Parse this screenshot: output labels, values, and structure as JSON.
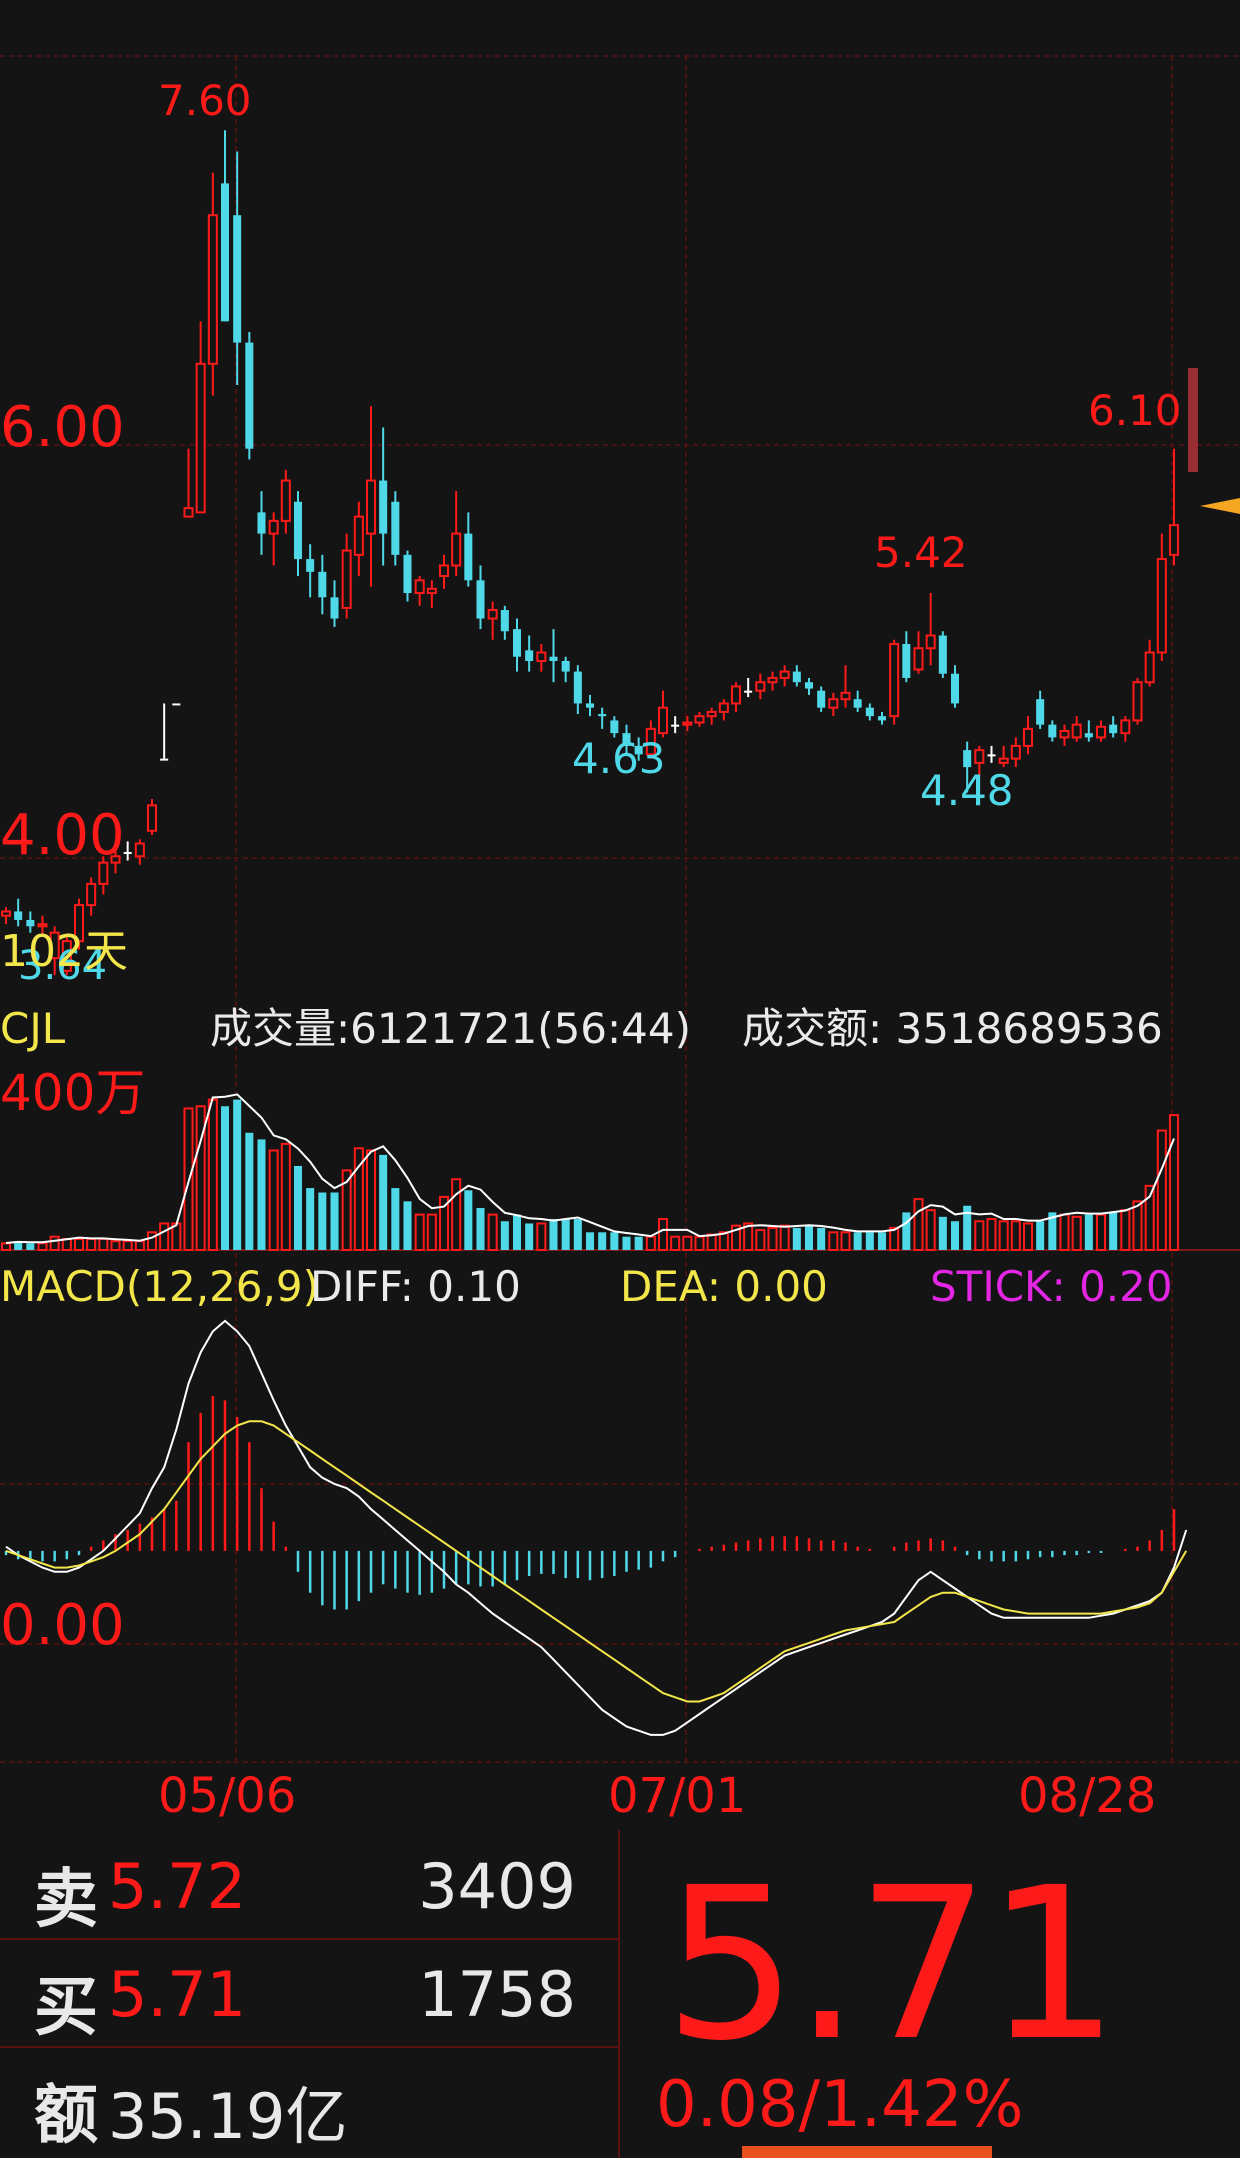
{
  "price_axis": {
    "label_high": "6.00",
    "label_low": "4.00"
  },
  "annotations": {
    "high": "7.60",
    "current_high": "6.10",
    "mid_high": "5.42",
    "low_1": "4.63",
    "low_2": "4.48",
    "low_left": "3.64",
    "days": "102天"
  },
  "volume": {
    "name": "CJL",
    "volume_text": "成交量:6121721(56:44)",
    "amount_text": "成交额: 3518689536",
    "axis_label": "400万"
  },
  "macd": {
    "name": "MACD(12,26,9)",
    "diff_text": "DIFF: 0.10",
    "dea_text": "DEA: 0.00",
    "stick_text": "STICK: 0.20",
    "axis_zero": "0.00"
  },
  "dates": [
    "05/06",
    "07/01",
    "08/28"
  ],
  "quote": {
    "sell_key": "卖",
    "sell_price": "5.72",
    "sell_volume": "3409",
    "buy_key": "买",
    "buy_price": "5.71",
    "buy_volume": "1758",
    "amount_key": "额",
    "amount_value": "35.19亿",
    "last_price": "5.71",
    "change": "0.08/1.42%"
  },
  "colors": {
    "up": "#ff1a1a",
    "down": "#4fd8e8",
    "dea": "#f3e64a",
    "diff": "#ffffff",
    "grid": "#5a1111",
    "background": "#141414"
  },
  "chart_data": {
    "type": "candlestick",
    "ohlc": [
      [
        3.9,
        3.94,
        3.86,
        3.92
      ],
      [
        3.92,
        3.98,
        3.85,
        3.88
      ],
      [
        3.88,
        3.92,
        3.82,
        3.85
      ],
      [
        3.85,
        3.9,
        3.8,
        3.86
      ],
      [
        3.7,
        3.85,
        3.62,
        3.82
      ],
      [
        3.64,
        3.8,
        3.62,
        3.78
      ],
      [
        3.78,
        3.98,
        3.74,
        3.95
      ],
      [
        3.95,
        4.08,
        3.9,
        4.05
      ],
      [
        4.05,
        4.18,
        4.0,
        4.15
      ],
      [
        4.15,
        4.22,
        4.1,
        4.18
      ],
      [
        4.2,
        4.25,
        4.16,
        4.2
      ],
      [
        4.18,
        4.26,
        4.14,
        4.24
      ],
      [
        4.3,
        4.45,
        4.28,
        4.42
      ],
      [
        4.64,
        4.9,
        4.64,
        4.64
      ],
      [
        4.9,
        4.9,
        4.9,
        4.9
      ],
      [
        5.78,
        6.1,
        5.8,
        5.82
      ],
      [
        5.8,
        6.7,
        5.8,
        6.5
      ],
      [
        6.5,
        7.4,
        6.35,
        7.2
      ],
      [
        7.35,
        7.6,
        6.7,
        6.7
      ],
      [
        7.2,
        7.5,
        6.4,
        6.6
      ],
      [
        6.6,
        6.65,
        6.05,
        6.1
      ],
      [
        5.8,
        5.9,
        5.6,
        5.7
      ],
      [
        5.7,
        5.8,
        5.55,
        5.76
      ],
      [
        5.76,
        6.0,
        5.7,
        5.95
      ],
      [
        5.85,
        5.9,
        5.5,
        5.58
      ],
      [
        5.58,
        5.65,
        5.4,
        5.52
      ],
      [
        5.52,
        5.6,
        5.32,
        5.4
      ],
      [
        5.4,
        5.48,
        5.26,
        5.3
      ],
      [
        5.35,
        5.7,
        5.3,
        5.62
      ],
      [
        5.6,
        5.85,
        5.5,
        5.78
      ],
      [
        5.7,
        6.3,
        5.45,
        5.95
      ],
      [
        5.95,
        6.2,
        5.55,
        5.7
      ],
      [
        5.85,
        5.9,
        5.55,
        5.6
      ],
      [
        5.6,
        5.62,
        5.38,
        5.42
      ],
      [
        5.42,
        5.5,
        5.36,
        5.48
      ],
      [
        5.42,
        5.48,
        5.35,
        5.44
      ],
      [
        5.5,
        5.6,
        5.44,
        5.55
      ],
      [
        5.55,
        5.9,
        5.5,
        5.7
      ],
      [
        5.7,
        5.8,
        5.45,
        5.48
      ],
      [
        5.48,
        5.55,
        5.25,
        5.3
      ],
      [
        5.3,
        5.38,
        5.2,
        5.34
      ],
      [
        5.34,
        5.36,
        5.2,
        5.24
      ],
      [
        5.25,
        5.3,
        5.05,
        5.12
      ],
      [
        5.15,
        5.22,
        5.05,
        5.1
      ],
      [
        5.1,
        5.18,
        5.05,
        5.14
      ],
      [
        5.12,
        5.25,
        5.0,
        5.1
      ],
      [
        5.1,
        5.12,
        5.0,
        5.05
      ],
      [
        5.05,
        5.08,
        4.85,
        4.9
      ],
      [
        4.9,
        4.94,
        4.84,
        4.88
      ],
      [
        4.85,
        4.88,
        4.78,
        4.84
      ],
      [
        4.82,
        4.84,
        4.74,
        4.76
      ],
      [
        4.76,
        4.8,
        4.66,
        4.7
      ],
      [
        4.7,
        4.74,
        4.63,
        4.66
      ],
      [
        4.66,
        4.82,
        4.64,
        4.78
      ],
      [
        4.76,
        4.96,
        4.74,
        4.88
      ],
      [
        4.8,
        4.84,
        4.76,
        4.8
      ],
      [
        4.8,
        4.84,
        4.77,
        4.81
      ],
      [
        4.81,
        4.86,
        4.79,
        4.84
      ],
      [
        4.84,
        4.88,
        4.8,
        4.86
      ],
      [
        4.86,
        4.92,
        4.82,
        4.9
      ],
      [
        4.9,
        5.0,
        4.86,
        4.98
      ],
      [
        4.96,
        5.02,
        4.93,
        4.96
      ],
      [
        4.96,
        5.04,
        4.92,
        5.0
      ],
      [
        5.0,
        5.05,
        4.96,
        5.02
      ],
      [
        5.02,
        5.08,
        4.98,
        5.05
      ],
      [
        5.05,
        5.08,
        4.98,
        5.0
      ],
      [
        5.0,
        5.02,
        4.94,
        4.97
      ],
      [
        4.96,
        4.98,
        4.86,
        4.88
      ],
      [
        4.88,
        4.95,
        4.84,
        4.92
      ],
      [
        4.92,
        5.08,
        4.88,
        4.95
      ],
      [
        4.92,
        4.96,
        4.86,
        4.88
      ],
      [
        4.88,
        4.9,
        4.82,
        4.84
      ],
      [
        4.84,
        4.86,
        4.8,
        4.82
      ],
      [
        4.84,
        5.2,
        4.8,
        5.18
      ],
      [
        5.18,
        5.24,
        5.0,
        5.02
      ],
      [
        5.06,
        5.24,
        5.04,
        5.16
      ],
      [
        5.16,
        5.42,
        5.08,
        5.22
      ],
      [
        5.22,
        5.24,
        5.02,
        5.04
      ],
      [
        5.04,
        5.08,
        4.88,
        4.9
      ],
      [
        4.68,
        4.72,
        4.48,
        4.6
      ],
      [
        4.62,
        4.7,
        4.56,
        4.68
      ],
      [
        4.66,
        4.7,
        4.62,
        4.66
      ],
      [
        4.62,
        4.7,
        4.6,
        4.64
      ],
      [
        4.64,
        4.74,
        4.6,
        4.7
      ],
      [
        4.7,
        4.84,
        4.66,
        4.78
      ],
      [
        4.92,
        4.96,
        4.78,
        4.8
      ],
      [
        4.8,
        4.82,
        4.72,
        4.74
      ],
      [
        4.74,
        4.8,
        4.7,
        4.77
      ],
      [
        4.74,
        4.84,
        4.72,
        4.8
      ],
      [
        4.76,
        4.82,
        4.72,
        4.74
      ],
      [
        4.74,
        4.82,
        4.72,
        4.79
      ],
      [
        4.8,
        4.84,
        4.74,
        4.76
      ],
      [
        4.76,
        4.84,
        4.72,
        4.82
      ],
      [
        4.82,
        5.02,
        4.8,
        5.0
      ],
      [
        5.0,
        5.2,
        4.98,
        5.14
      ],
      [
        5.14,
        5.7,
        5.1,
        5.58
      ],
      [
        5.6,
        6.1,
        5.55,
        5.74
      ]
    ],
    "volume": [
      0.3,
      0.4,
      0.3,
      0.3,
      0.6,
      0.5,
      0.5,
      0.5,
      0.5,
      0.4,
      0.4,
      0.4,
      0.8,
      1.2,
      1.2,
      6.4,
      6.5,
      6.8,
      6.5,
      6.8,
      5.3,
      5.0,
      4.5,
      4.8,
      3.8,
      2.8,
      2.6,
      2.6,
      3.6,
      4.6,
      4.5,
      4.3,
      2.8,
      2.2,
      1.6,
      1.6,
      2.4,
      3.2,
      2.7,
      1.9,
      1.6,
      1.3,
      1.6,
      1.2,
      1.2,
      1.4,
      1.4,
      1.4,
      0.8,
      0.8,
      0.8,
      0.6,
      0.6,
      0.6,
      1.4,
      0.6,
      0.6,
      0.6,
      0.7,
      0.8,
      1.1,
      1.2,
      0.9,
      1.0,
      1.1,
      1.0,
      1.1,
      1.0,
      0.8,
      0.8,
      0.8,
      0.8,
      0.8,
      1.0,
      1.7,
      2.3,
      1.8,
      1.5,
      1.3,
      2.0,
      1.3,
      1.4,
      1.3,
      1.3,
      1.2,
      1.3,
      1.7,
      1.6,
      1.5,
      1.6,
      1.6,
      1.7,
      1.8,
      2.2,
      2.9,
      5.4,
      6.1
    ],
    "stick": [
      -0.02,
      -0.04,
      -0.05,
      -0.05,
      -0.05,
      -0.04,
      -0.02,
      0.02,
      0.05,
      0.08,
      0.1,
      0.13,
      0.16,
      0.2,
      0.24,
      0.52,
      0.66,
      0.74,
      0.72,
      0.64,
      0.52,
      0.3,
      0.14,
      0.02,
      -0.1,
      -0.2,
      -0.26,
      -0.28,
      -0.28,
      -0.24,
      -0.2,
      -0.16,
      -0.18,
      -0.2,
      -0.21,
      -0.2,
      -0.18,
      -0.16,
      -0.16,
      -0.17,
      -0.17,
      -0.16,
      -0.14,
      -0.12,
      -0.11,
      -0.11,
      -0.13,
      -0.13,
      -0.14,
      -0.13,
      -0.12,
      -0.1,
      -0.09,
      -0.08,
      -0.05,
      -0.03,
      0.0,
      0.01,
      0.02,
      0.03,
      0.04,
      0.05,
      0.06,
      0.07,
      0.07,
      0.07,
      0.06,
      0.05,
      0.05,
      0.04,
      0.02,
      0.01,
      0.0,
      0.02,
      0.04,
      0.05,
      0.06,
      0.05,
      0.02,
      -0.02,
      -0.04,
      -0.05,
      -0.05,
      -0.05,
      -0.04,
      -0.03,
      -0.03,
      -0.02,
      -0.02,
      -0.01,
      -0.01,
      0.0,
      0.01,
      0.02,
      0.05,
      0.1,
      0.2
    ],
    "diff": [
      0.02,
      -0.02,
      -0.05,
      -0.08,
      -0.1,
      -0.1,
      -0.08,
      -0.04,
      0.0,
      0.06,
      0.12,
      0.18,
      0.3,
      0.4,
      0.58,
      0.8,
      0.95,
      1.05,
      1.1,
      1.05,
      0.98,
      0.85,
      0.72,
      0.6,
      0.5,
      0.4,
      0.35,
      0.32,
      0.3,
      0.26,
      0.2,
      0.15,
      0.1,
      0.05,
      0.0,
      -0.05,
      -0.1,
      -0.16,
      -0.2,
      -0.25,
      -0.3,
      -0.34,
      -0.38,
      -0.42,
      -0.46,
      -0.52,
      -0.58,
      -0.64,
      -0.7,
      -0.76,
      -0.8,
      -0.84,
      -0.86,
      -0.88,
      -0.88,
      -0.86,
      -0.82,
      -0.78,
      -0.74,
      -0.7,
      -0.66,
      -0.62,
      -0.58,
      -0.54,
      -0.5,
      -0.48,
      -0.46,
      -0.44,
      -0.42,
      -0.4,
      -0.38,
      -0.36,
      -0.34,
      -0.3,
      -0.22,
      -0.14,
      -0.1,
      -0.14,
      -0.18,
      -0.22,
      -0.26,
      -0.3,
      -0.32,
      -0.32,
      -0.32,
      -0.32,
      -0.32,
      -0.32,
      -0.32,
      -0.32,
      -0.31,
      -0.3,
      -0.28,
      -0.26,
      -0.24,
      -0.2,
      -0.08,
      0.1
    ],
    "dea": [
      0.0,
      -0.02,
      -0.04,
      -0.06,
      -0.08,
      -0.08,
      -0.07,
      -0.05,
      -0.03,
      0.0,
      0.04,
      0.08,
      0.14,
      0.2,
      0.28,
      0.36,
      0.44,
      0.5,
      0.56,
      0.6,
      0.62,
      0.62,
      0.6,
      0.56,
      0.52,
      0.48,
      0.44,
      0.4,
      0.36,
      0.32,
      0.28,
      0.24,
      0.2,
      0.16,
      0.12,
      0.08,
      0.04,
      0.0,
      -0.04,
      -0.08,
      -0.12,
      -0.16,
      -0.2,
      -0.24,
      -0.28,
      -0.32,
      -0.36,
      -0.4,
      -0.44,
      -0.48,
      -0.52,
      -0.56,
      -0.6,
      -0.64,
      -0.68,
      -0.7,
      -0.72,
      -0.72,
      -0.7,
      -0.68,
      -0.64,
      -0.6,
      -0.56,
      -0.52,
      -0.48,
      -0.46,
      -0.44,
      -0.42,
      -0.4,
      -0.38,
      -0.37,
      -0.36,
      -0.35,
      -0.34,
      -0.3,
      -0.26,
      -0.22,
      -0.2,
      -0.2,
      -0.22,
      -0.24,
      -0.26,
      -0.28,
      -0.29,
      -0.3,
      -0.3,
      -0.3,
      -0.3,
      -0.3,
      -0.3,
      -0.3,
      -0.29,
      -0.28,
      -0.27,
      -0.25,
      -0.2,
      -0.1,
      0.0
    ],
    "price_range": [
      3.55,
      7.95
    ],
    "volume_max": 8.5,
    "macd_range": [
      -1.0,
      1.2
    ]
  }
}
